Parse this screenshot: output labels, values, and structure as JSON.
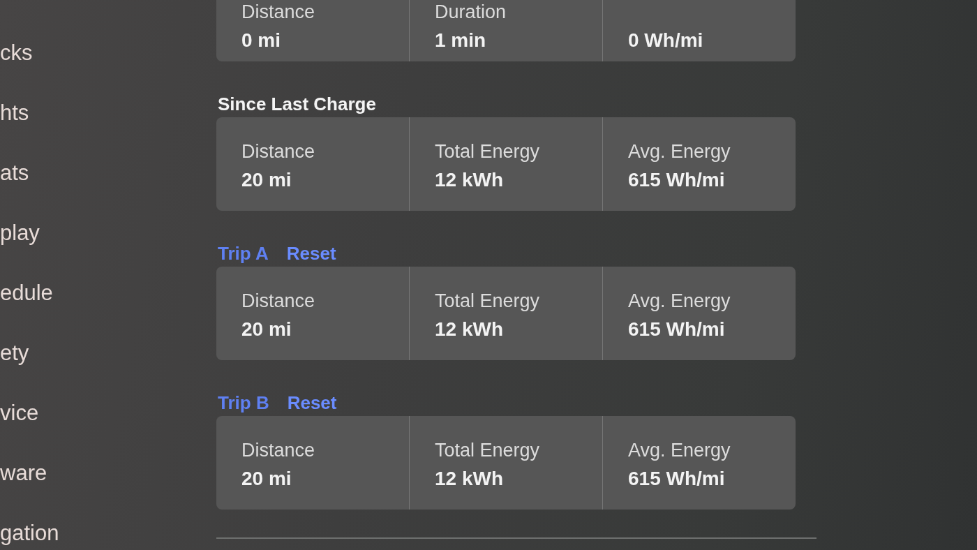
{
  "sidebar": {
    "items": [
      {
        "label": "cks"
      },
      {
        "label": "hts"
      },
      {
        "label": "ats"
      },
      {
        "label": "play"
      },
      {
        "label": "edule"
      },
      {
        "label": "ety"
      },
      {
        "label": "vice"
      },
      {
        "label": "ware"
      },
      {
        "label": "gation"
      }
    ]
  },
  "sections": [
    {
      "stats": [
        {
          "label": "Distance",
          "value": "0 mi"
        },
        {
          "label": "Duration",
          "value": "1 min"
        },
        {
          "value": "0 Wh/mi"
        }
      ]
    },
    {
      "heading": {
        "text": "Since Last Charge",
        "kind": "plain"
      },
      "stats": [
        {
          "label": "Distance",
          "value": "20 mi"
        },
        {
          "label": "Total Energy",
          "value": "12 kWh"
        },
        {
          "label": "Avg. Energy",
          "value": "615 Wh/mi"
        }
      ]
    },
    {
      "heading": {
        "text": "Trip A",
        "kind": "link"
      },
      "action": {
        "label": "Reset"
      },
      "stats": [
        {
          "label": "Distance",
          "value": "20 mi"
        },
        {
          "label": "Total Energy",
          "value": "12 kWh"
        },
        {
          "label": "Avg. Energy",
          "value": "615 Wh/mi"
        }
      ]
    },
    {
      "heading": {
        "text": "Trip B",
        "kind": "link"
      },
      "action": {
        "label": "Reset"
      },
      "stats": [
        {
          "label": "Distance",
          "value": "20 mi"
        },
        {
          "label": "Total Energy",
          "value": "12 kWh"
        },
        {
          "label": "Avg. Energy",
          "value": "615 Wh/mi"
        }
      ]
    }
  ]
}
